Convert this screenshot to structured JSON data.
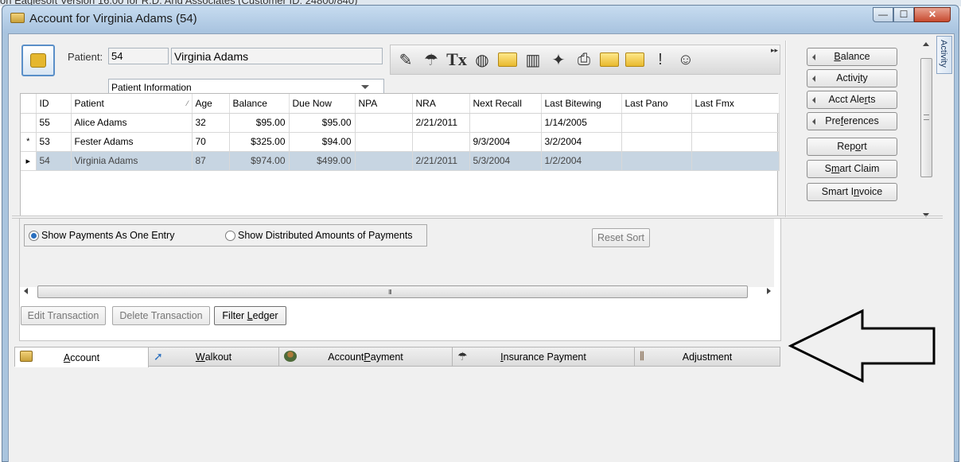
{
  "background_title": "on Eaglesoft Version 16.00 for R.D. And Associates (Customer ID: 24800/840)",
  "window": {
    "title": "Account for Virginia Adams (54)",
    "controls": {
      "minimize": "—",
      "maximize": "☐",
      "close": "✕"
    }
  },
  "patient": {
    "label": "Patient:",
    "id": "54",
    "name": "Virginia Adams",
    "view_select": "Patient Information"
  },
  "toolbar": {
    "icons": [
      "signature-pen-icon",
      "insurance-umbrella-icon",
      "tx-icon",
      "brain-icon",
      "folder-check-icon",
      "family-chart-icon",
      "note-star-icon",
      "printer-icon",
      "folder-card-icon",
      "folder-icon",
      "alert-person-icon",
      "person-hand-icon"
    ],
    "tx_label": "Tx",
    "more": "▸▸"
  },
  "grid": {
    "columns": [
      "ID",
      "Patient",
      "Age",
      "Balance",
      "Due Now",
      "NPA",
      "NRA",
      "Next Recall",
      "Last Bitewing",
      "Last Pano",
      "Last Fmx"
    ],
    "sort_indicator": "⁄",
    "rows": [
      {
        "marker": "",
        "id": "55",
        "patient": "Alice Adams",
        "age": "32",
        "balance": "$95.00",
        "due_now": "$95.00",
        "npa": "",
        "nra": "2/21/2011",
        "next_recall": "",
        "last_bitewing": "1/14/2005",
        "last_pano": "",
        "last_fmx": ""
      },
      {
        "marker": "*",
        "id": "53",
        "patient": "Fester Adams",
        "age": "70",
        "balance": "$325.00",
        "due_now": "$94.00",
        "npa": "",
        "nra": "",
        "next_recall": "9/3/2004",
        "last_bitewing": "3/2/2004",
        "last_pano": "",
        "last_fmx": ""
      },
      {
        "marker": "▸",
        "id": "54",
        "patient": "Virginia Adams",
        "age": "87",
        "balance": "$974.00",
        "due_now": "$499.00",
        "npa": "",
        "nra": "2/21/2011",
        "next_recall": "5/3/2004",
        "last_bitewing": "1/2/2004",
        "last_pano": "",
        "last_fmx": ""
      }
    ]
  },
  "side_buttons": {
    "balance": {
      "pre": "",
      "key": "B",
      "post": "alance"
    },
    "activity": {
      "pre": "Activ",
      "key": "i",
      "post": "ty"
    },
    "acct_alerts": {
      "pre": "Acct Ale",
      "key": "r",
      "post": "ts"
    },
    "preferences": {
      "pre": "Pre",
      "key": "f",
      "post": "erences"
    },
    "report": {
      "pre": "Rep",
      "key": "o",
      "post": "rt"
    },
    "smart_claim": {
      "pre": "S",
      "key": "m",
      "post": "art Claim"
    },
    "smart_invoice": {
      "pre": "Smart I",
      "key": "n",
      "post": "voice"
    }
  },
  "activity_tab": "Activity",
  "ledger": {
    "radio_one": "Show Payments As One Entry",
    "radio_dist": "Show Distributed Amounts of Payments",
    "reset_sort": "Reset Sort",
    "scroll_grip": "III",
    "edit_transaction": "Edit Transaction",
    "delete_transaction": "Delete Transaction",
    "filter_ledger": {
      "pre": "Filter ",
      "key": "L",
      "post": "edger"
    }
  },
  "tabs": {
    "account": {
      "pre": "",
      "key": "A",
      "post": "ccount"
    },
    "walkout": {
      "pre": "",
      "key": "W",
      "post": "alkout"
    },
    "account_payment": {
      "pre": "Account ",
      "key": "P",
      "post": "ayment"
    },
    "insurance_payment": {
      "pre": "",
      "key": "I",
      "post": "nsurance Payment"
    },
    "adjustment": {
      "pre": "",
      "key": "",
      "post": "Adjustment"
    }
  },
  "colors": {
    "selected_row": "#c7d5e2",
    "title_bar": "#a8c3df",
    "radio_accent": "#2a6fbf"
  }
}
